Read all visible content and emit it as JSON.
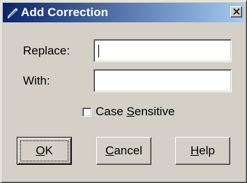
{
  "window": {
    "title": "Add Correction",
    "close_glyph": "✕",
    "icon": "pencil-feather-icon"
  },
  "form": {
    "replace_label": "Replace:",
    "replace_value": "",
    "with_label": "With:",
    "with_value": "",
    "case_sensitive": {
      "label_before": "Case ",
      "label_mnemonic": "S",
      "label_after": "ensitive",
      "checked": false
    }
  },
  "buttons": {
    "ok": {
      "mnemonic": "O",
      "rest": "K"
    },
    "cancel": {
      "mnemonic": "C",
      "rest": "ancel"
    },
    "help": {
      "mnemonic": "H",
      "rest": "elp"
    }
  },
  "colors": {
    "face": "#d4d0c8",
    "title_start": "#0a246a",
    "title_end": "#a6caf0"
  }
}
